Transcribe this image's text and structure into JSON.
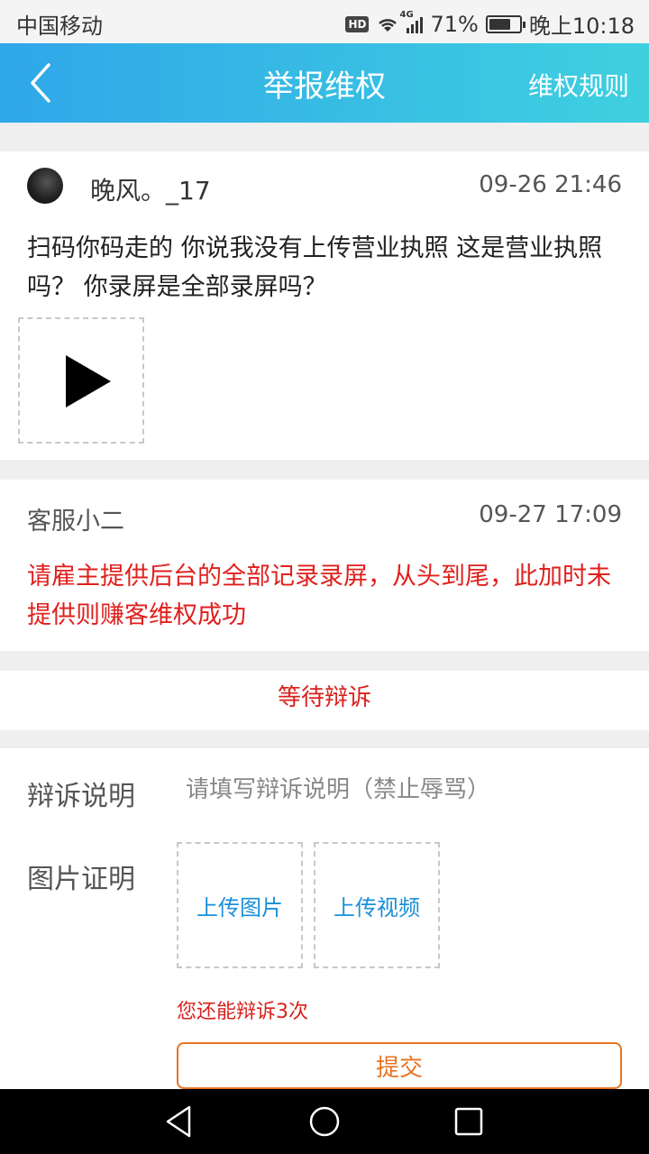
{
  "status_bar": {
    "carrier": "中国移动",
    "hd": "HD",
    "network": "4G",
    "battery": "71%",
    "battery_level": 0.71,
    "time": "晚上10:18"
  },
  "header": {
    "title": "举报维权",
    "rules_link": "维权规则",
    "back_icon": "chevron-left-icon"
  },
  "post": {
    "username": "晚风。_17",
    "time": "09-26 21:46",
    "content": "扫码你码走的 你说我没有上传营业执照 这是营业执照吗？ 你录屏是全部录屏吗？",
    "video_icon": "play-icon"
  },
  "reply": {
    "author": "客服小二",
    "time": "09-27 17:09",
    "content": "请雇主提供后台的全部记录录屏，从头到尾，此加时未提供则赚客维权成功",
    "content_color": "#e0201d"
  },
  "appeal_status": {
    "label": "等待辩诉"
  },
  "form": {
    "explain_label": "辩诉说明",
    "explain_placeholder": "请填写辩诉说明（禁止辱骂）",
    "explain_value": "",
    "proof_label": "图片证明",
    "upload_image": "上传图片",
    "upload_video": "上传视频",
    "remaining": "您还能辩诉3次",
    "submit": "提交"
  },
  "colors": {
    "header_gradient_start": "#2fa7e9",
    "header_gradient_end": "#3fd0e0",
    "alert_red": "#d9211b",
    "link_blue": "#1a8fd9",
    "submit_orange": "#e8731f"
  }
}
